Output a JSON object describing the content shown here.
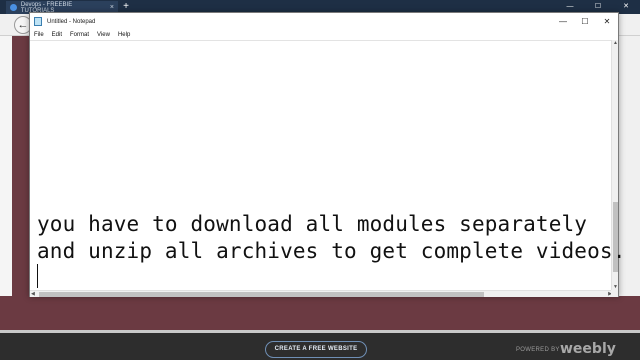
{
  "browser": {
    "tab_title": "Devops - FREEBIE TUTORIALS",
    "tab_close": "×",
    "new_tab": "+",
    "window_controls": {
      "minimize": "—",
      "maximize": "☐",
      "close": "✕"
    },
    "back_button": "←"
  },
  "notepad": {
    "title": "Untitled - Notepad",
    "controls": {
      "minimize": "—",
      "maximize": "☐",
      "close": "✕"
    },
    "menu": [
      "File",
      "Edit",
      "Format",
      "View",
      "Help"
    ],
    "content": {
      "line1": "you have to download all modules separately",
      "line2": "and unzip all archives to get complete videos."
    },
    "scroll_arrows": {
      "up": "▲",
      "down": "▼",
      "left": "◀",
      "right": "▶"
    }
  },
  "footer": {
    "cta_label": "CREATE A FREE WEBSITE",
    "powered_by": "POWERED BY",
    "logo_text": "weebly"
  }
}
